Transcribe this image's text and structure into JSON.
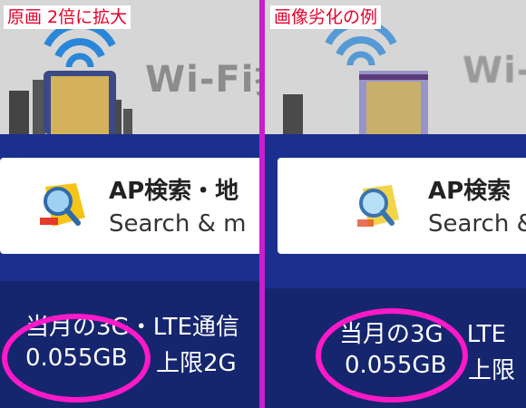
{
  "left_panel": {
    "label": "原画 2倍に拡大",
    "banner_text": "Wi-Fi拉",
    "card": {
      "title": "AP検索・地",
      "subtitle": "Search & m"
    },
    "usage": {
      "title": "当月の3G・LTE通信",
      "amount": "0.055GB",
      "limit": "上限2G"
    }
  },
  "right_panel": {
    "label": "画像劣化の例",
    "banner_text": "Wi-I",
    "card": {
      "title": "AP検索",
      "subtitle": "Search &"
    },
    "usage": {
      "title": "当月の3G・LTE",
      "amount": "0.055GB",
      "limit": "上限"
    }
  },
  "colors": {
    "background": "#1b2f8e",
    "divider": "#c81ecf",
    "highlight_ellipse": "#ff19c8",
    "label_text": "#e8002a"
  }
}
